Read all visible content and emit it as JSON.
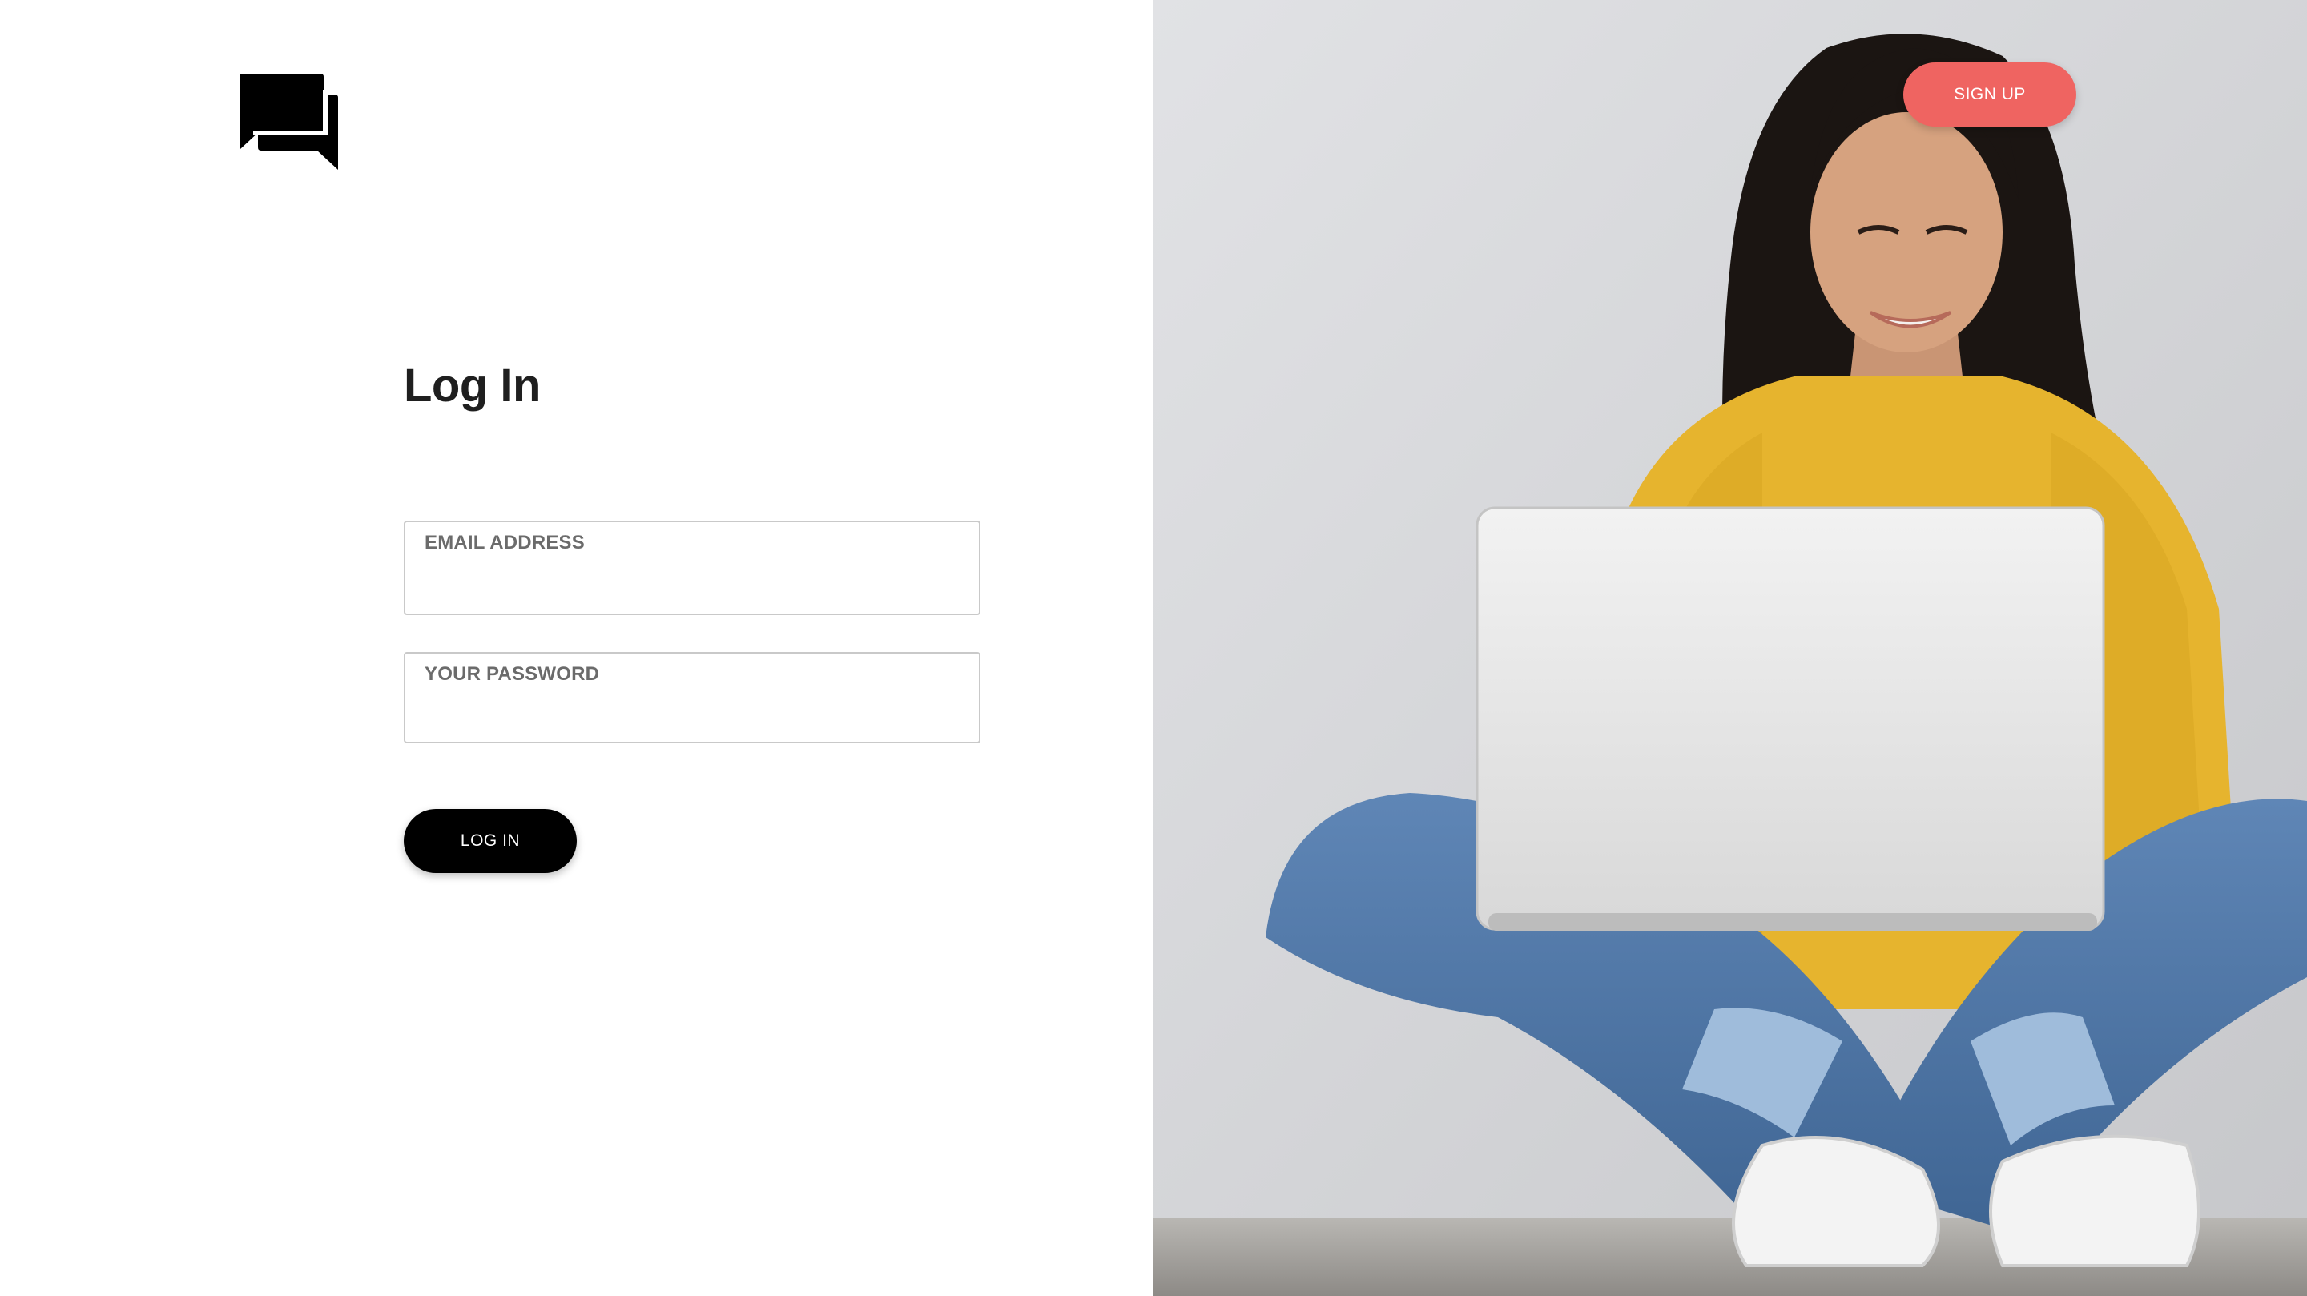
{
  "logo": {
    "icon": "chat-bubbles-icon"
  },
  "login_form": {
    "title": "Log In",
    "email_label": "EMAIL ADDRESS",
    "email_value": "",
    "password_label": "YOUR PASSWORD",
    "password_value": "",
    "submit_label": "LOG IN"
  },
  "header": {
    "signup_label": "SIGN UP"
  },
  "hero": {
    "image": "woman-with-laptop-photo"
  },
  "colors": {
    "signup_accent": "#ef6461",
    "login_button": "#000000",
    "title_text": "#1f1f1f",
    "label_text": "#6b6b6b"
  }
}
